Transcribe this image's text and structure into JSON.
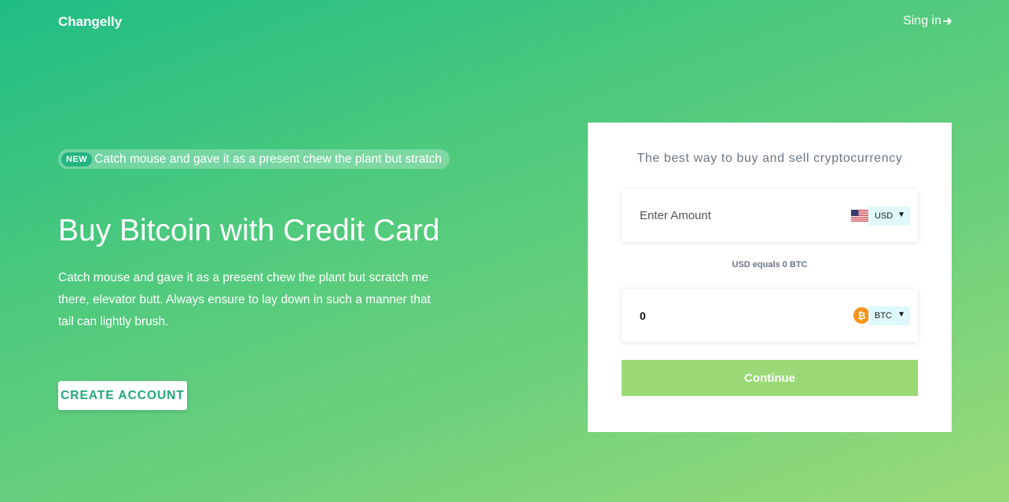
{
  "header": {
    "logo": "Changelly",
    "signin_label": "Sing in"
  },
  "hero": {
    "badge": "NEW",
    "badge_text": "Catch mouse and gave it as a present chew the plant but stratch",
    "headline": "Buy Bitcoin with Credit Card",
    "description": "Catch mouse and gave it as a present chew the plant but scratch me there, elevator butt. Always ensure to lay down in such a manner that tail can lightly brush.",
    "create_button": "CREATE ACCOUNT"
  },
  "card": {
    "title": "The best way to buy and sell cryptocurrency",
    "amount_placeholder": "Enter Amount",
    "from_currency": "USD",
    "equals_text": "USD equals 0 BTC",
    "to_value": "0",
    "to_currency": "BTC",
    "continue_label": "Continue"
  },
  "colors": {
    "accent": "#23a878",
    "continue_bg": "#9bd977",
    "select_bg": "#def8fb",
    "bitcoin": "#f7931a"
  },
  "icons": {
    "signin": "arrow-right-icon",
    "usd": "us-flag-icon",
    "btc": "bitcoin-icon",
    "dropdown": "caret-down-icon"
  }
}
